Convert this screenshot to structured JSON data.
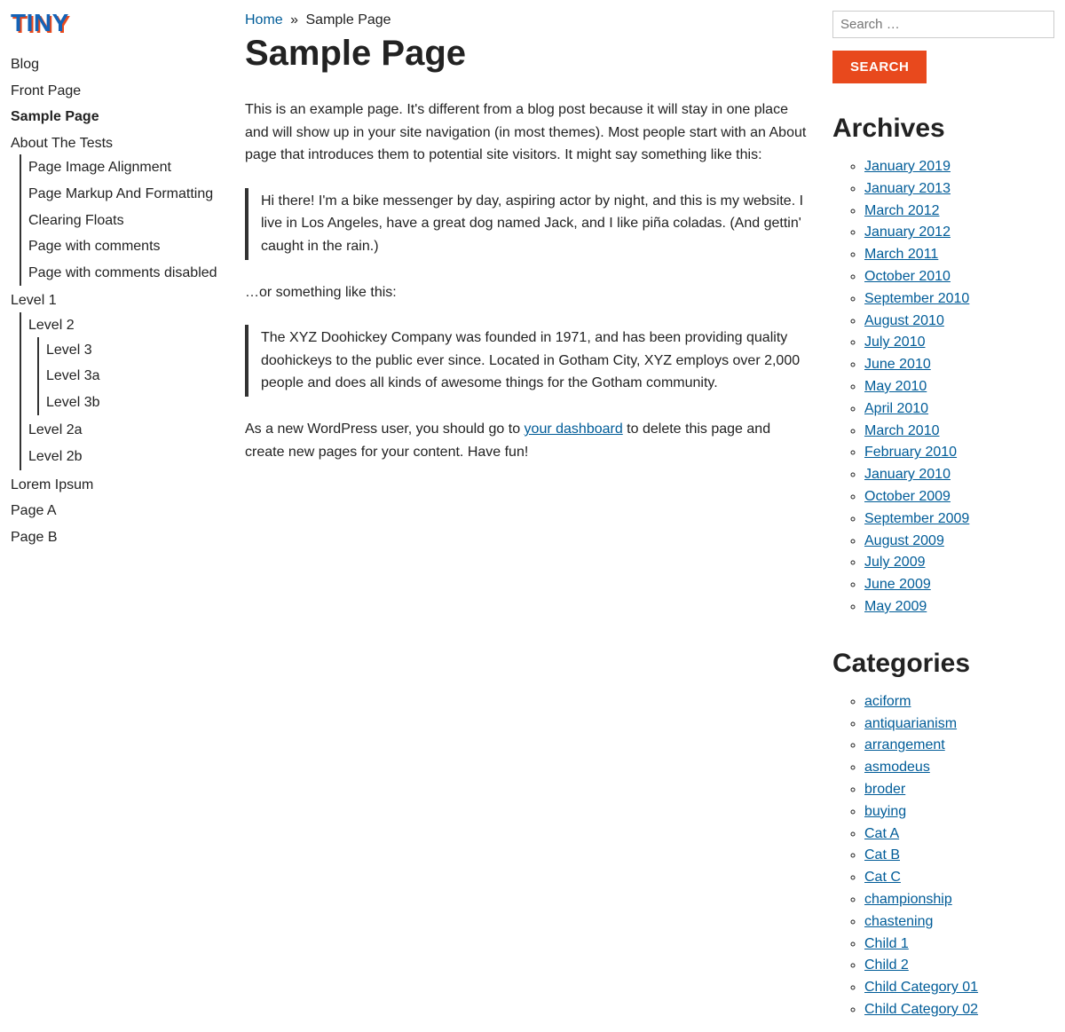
{
  "logo": "TINY",
  "nav": [
    {
      "label": "Blog"
    },
    {
      "label": "Front Page"
    },
    {
      "label": "Sample Page",
      "current": true
    },
    {
      "label": "About The Tests",
      "children": [
        {
          "label": "Page Image Alignment"
        },
        {
          "label": "Page Markup And Formatting"
        },
        {
          "label": "Clearing Floats"
        },
        {
          "label": "Page with comments"
        },
        {
          "label": "Page with comments disabled"
        }
      ]
    },
    {
      "label": "Level 1",
      "children": [
        {
          "label": "Level 2",
          "children": [
            {
              "label": "Level 3"
            },
            {
              "label": "Level 3a"
            },
            {
              "label": "Level 3b"
            }
          ]
        },
        {
          "label": "Level 2a"
        },
        {
          "label": "Level 2b"
        }
      ]
    },
    {
      "label": "Lorem Ipsum"
    },
    {
      "label": "Page A"
    },
    {
      "label": "Page B"
    }
  ],
  "breadcrumb": {
    "home": "Home",
    "sep": "»",
    "current": "Sample Page"
  },
  "page_title": "Sample Page",
  "content": {
    "p1": "This is an example page. It's different from a blog post because it will stay in one place and will show up in your site navigation (in most themes). Most people start with an About page that introduces them to potential site visitors. It might say something like this:",
    "quote1": "Hi there! I'm a bike messenger by day, aspiring actor by night, and this is my website. I live in Los Angeles, have a great dog named Jack, and I like piña coladas. (And gettin' caught in the rain.)",
    "p2": "…or something like this:",
    "quote2": "The XYZ Doohickey Company was founded in 1971, and has been providing quality doohickeys to the public ever since. Located in Gotham City, XYZ employs over 2,000 people and does all kinds of awesome things for the Gotham community.",
    "p3_a": "As a new WordPress user, you should go to ",
    "p3_link": "your dashboard",
    "p3_b": " to delete this page and create new pages for your content. Have fun!"
  },
  "search": {
    "placeholder": "Search …",
    "button": "SEARCH"
  },
  "archives_heading": "Archives",
  "archives": [
    "January 2019",
    "January 2013",
    "March 2012",
    "January 2012",
    "March 2011",
    "October 2010",
    "September 2010",
    "August 2010",
    "July 2010",
    "June 2010",
    "May 2010",
    "April 2010",
    "March 2010",
    "February 2010",
    "January 2010",
    "October 2009",
    "September 2009",
    "August 2009",
    "July 2009",
    "June 2009",
    "May 2009"
  ],
  "categories_heading": "Categories",
  "categories": [
    "aciform",
    "antiquarianism",
    "arrangement",
    "asmodeus",
    "broder",
    "buying",
    "Cat A",
    "Cat B",
    "Cat C",
    "championship",
    "chastening",
    "Child 1",
    "Child 2",
    "Child Category 01",
    "Child Category 02"
  ]
}
